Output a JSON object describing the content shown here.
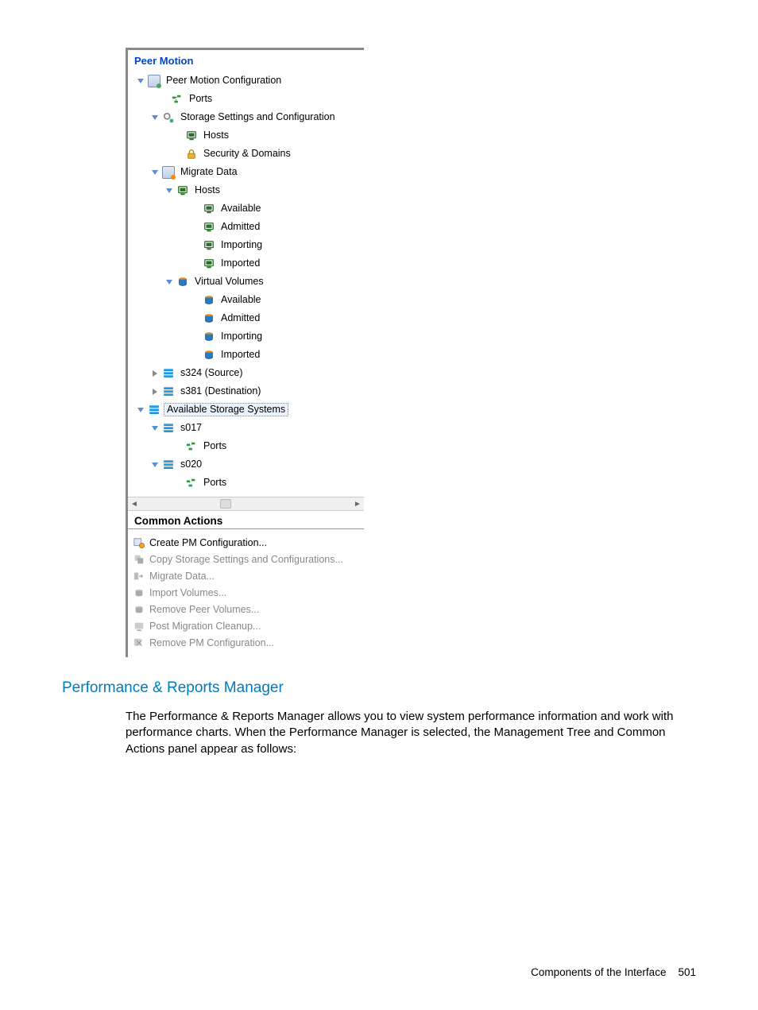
{
  "panel": {
    "title": "Peer Motion"
  },
  "tree": {
    "root": {
      "label": "Peer Motion Configuration",
      "children": {
        "ports": "Ports",
        "storage_settings": {
          "label": "Storage Settings and Configuration",
          "hosts": "Hosts",
          "security": "Security & Domains"
        },
        "migrate_data": {
          "label": "Migrate Data",
          "hosts": {
            "label": "Hosts",
            "available": "Available",
            "admitted": "Admitted",
            "importing": "Importing",
            "imported": "Imported"
          },
          "volumes": {
            "label": "Virtual Volumes",
            "available": "Available",
            "admitted": "Admitted",
            "importing": "Importing",
            "imported": "Imported"
          }
        },
        "s324": "s324 (Source)",
        "s381": "s381 (Destination)",
        "available_systems": {
          "label": "Available Storage Systems",
          "s017": {
            "label": "s017",
            "ports": "Ports"
          },
          "s020": {
            "label": "s020",
            "ports": "Ports"
          }
        }
      }
    }
  },
  "common_actions": {
    "title": "Common Actions",
    "items": [
      {
        "label": "Create PM Configuration...",
        "enabled": true
      },
      {
        "label": "Copy Storage Settings and Configurations...",
        "enabled": false
      },
      {
        "label": "Migrate Data...",
        "enabled": false
      },
      {
        "label": "Import Volumes...",
        "enabled": false
      },
      {
        "label": "Remove Peer Volumes...",
        "enabled": false
      },
      {
        "label": "Post Migration Cleanup...",
        "enabled": false
      },
      {
        "label": "Remove PM Configuration...",
        "enabled": false
      }
    ]
  },
  "doc": {
    "heading": "Performance & Reports Manager",
    "paragraph": "The Performance & Reports Manager allows you to view system performance information and work with performance charts. When the Performance Manager is selected, the Management Tree and Common Actions panel appear as follows:"
  },
  "footer": {
    "text": "Components of the Interface",
    "page": "501"
  }
}
